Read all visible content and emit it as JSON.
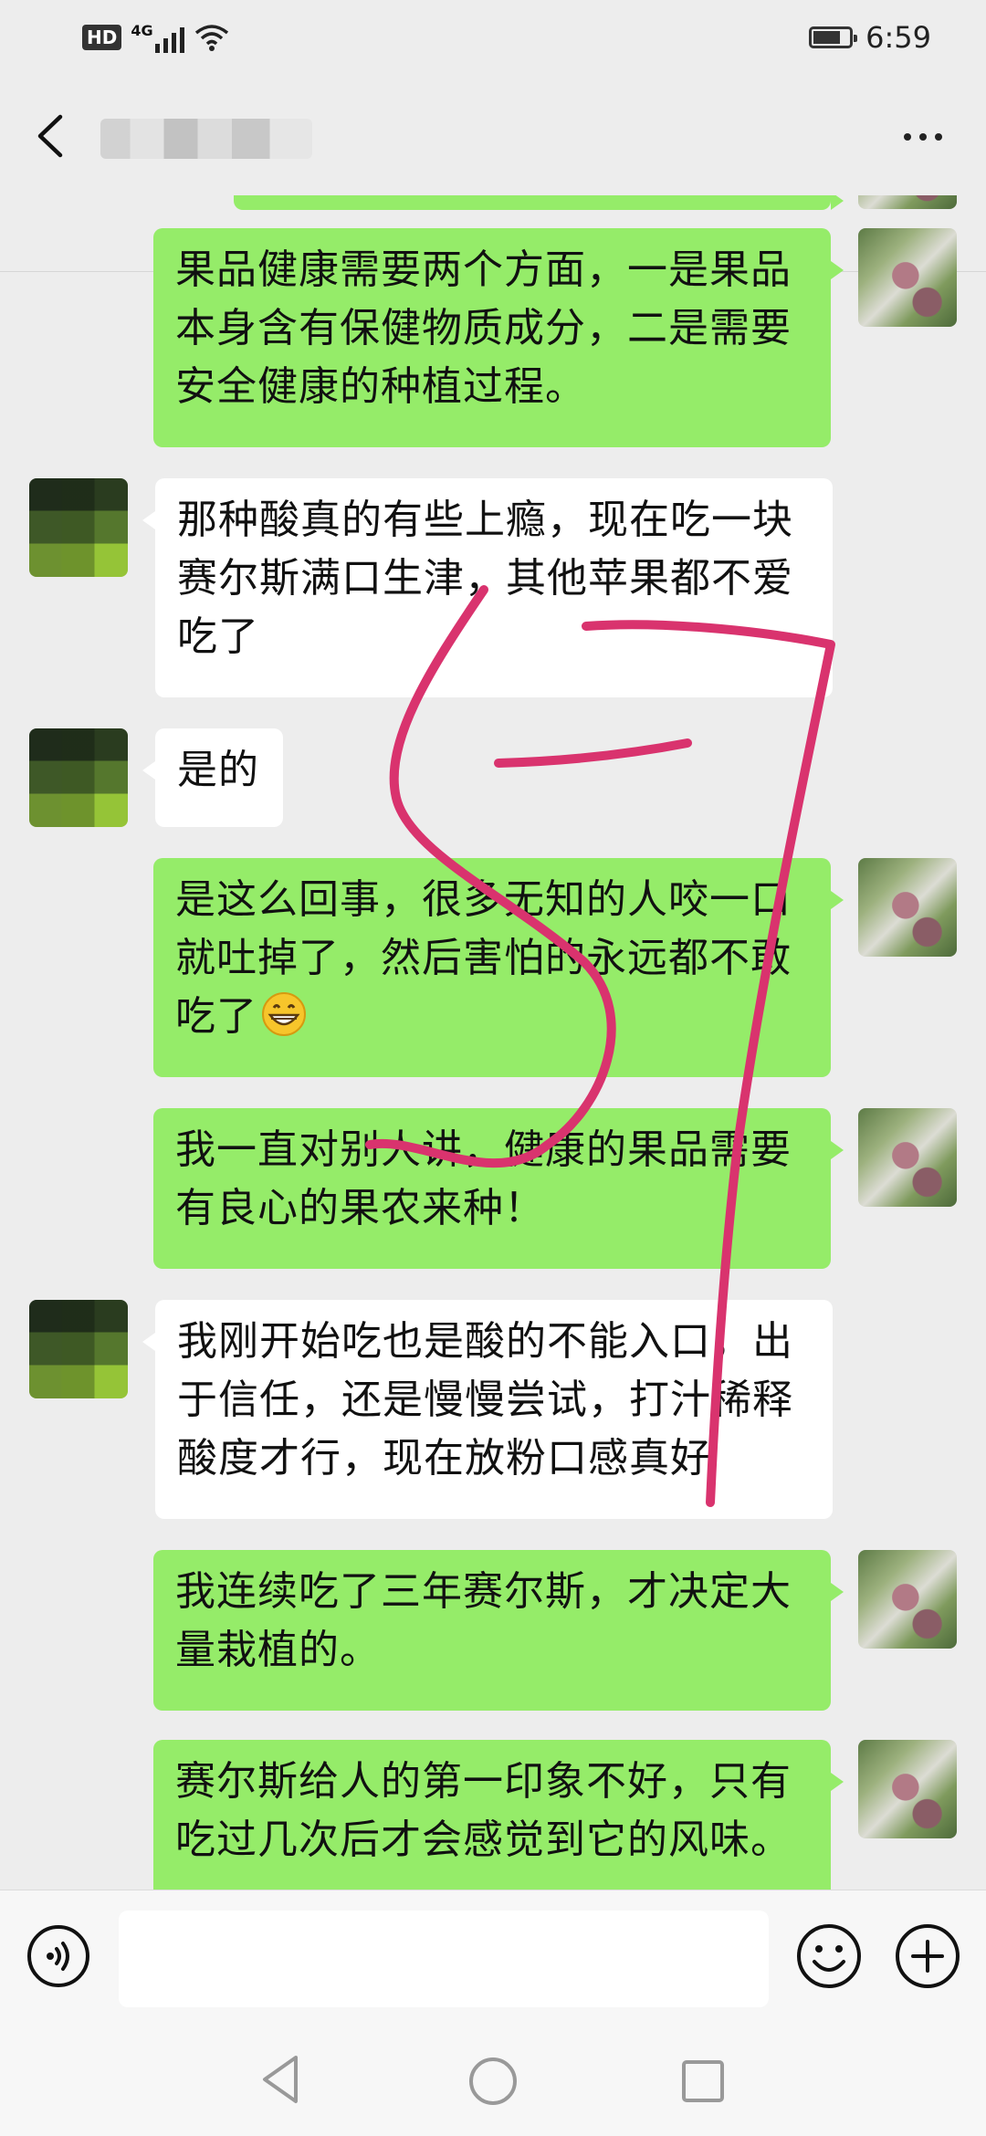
{
  "status_bar": {
    "network": "4G",
    "hd_label": "HD",
    "battery_level": 0.75,
    "time": "6:59"
  },
  "header": {
    "back_icon": "chevron-left-icon",
    "contact_name_blurred": true,
    "more_icon": "more-dots-icon"
  },
  "messages": [
    {
      "side": "mine",
      "text": "果品健康需要两个方面，一是果品本身含有保健物质成分，二是需要安全健康的种植过程。"
    },
    {
      "side": "other",
      "text": "那种酸真的有些上瘾，现在吃一块赛尔斯满口生津，其他苹果都不爱吃了"
    },
    {
      "side": "other",
      "text": "是的"
    },
    {
      "side": "mine",
      "text": "是这么回事，很多无知的人咬一口就吐掉了，然后害怕的永远都不敢吃了",
      "emoji": "grin-emoji"
    },
    {
      "side": "mine",
      "text": "我一直对别人讲，健康的果品需要有良心的果农来种！"
    },
    {
      "side": "other",
      "text": "我刚开始吃也是酸的不能入口，出于信任，还是慢慢尝试，打汁稀释酸度才行，现在放粉口感真好"
    },
    {
      "side": "mine",
      "text": "我连续吃了三年赛尔斯，才决定大量栽植的。"
    },
    {
      "side": "mine",
      "text": "赛尔斯给人的第一印象不好，只有吃过几次后才会感觉到它的风味。"
    }
  ],
  "annotation": {
    "color": "#d9336e",
    "description_icon": "handwritten-strokes"
  },
  "input_bar": {
    "voice_icon": "voice-icon",
    "input_value": "",
    "emoji_icon": "emoji-icon",
    "plus_icon": "plus-icon"
  },
  "nav_bar": {
    "back": "nav-back-icon",
    "home": "nav-home-icon",
    "recents": "nav-recents-icon"
  },
  "colors": {
    "background": "#ededed",
    "mine_bubble": "#95ec69",
    "other_bubble": "#ffffff"
  }
}
